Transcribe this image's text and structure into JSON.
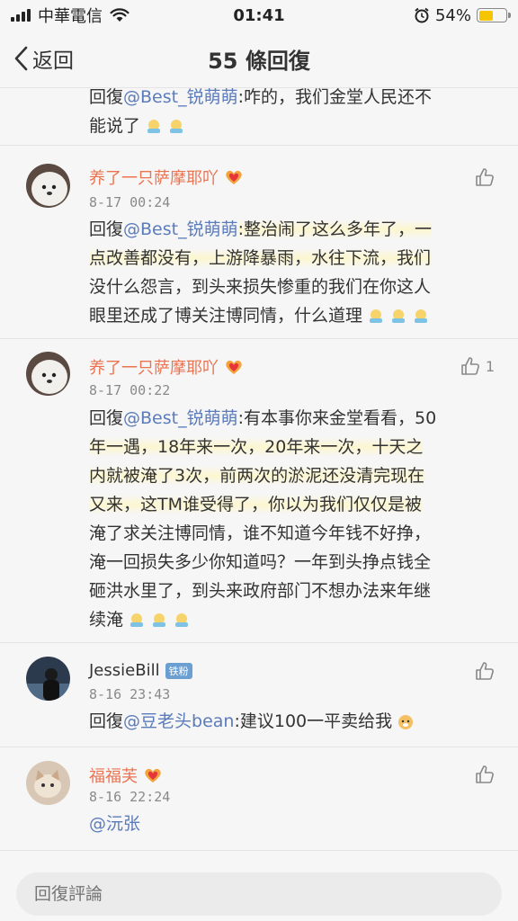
{
  "status_bar": {
    "carrier": "中華電信",
    "time": "01:41",
    "battery": "54%",
    "battery_level": 0.54
  },
  "nav": {
    "back_label": "返回",
    "title": "55 條回復"
  },
  "comments": [
    {
      "reply_prefix": "回復",
      "mention": "@Best_锐萌萌",
      "text": ":咋的，我们金堂人民还不能说了",
      "line1": ":咋的，我们金堂人民还不",
      "line2": "能说了"
    },
    {
      "username": "养了一只萨摩耶吖",
      "time": "8-17 00:24",
      "reply_prefix": "回復",
      "mention": "@Best_锐萌萌",
      "line1": ":整治闹了这么多年了，一",
      "line2": "点改善都没有，上游降暴雨，水往下流，我们",
      "line3": "没什么怨言，到头来损失惨重的我们在你这人",
      "line4": "眼里还成了博关注博同情，什么道理"
    },
    {
      "username": "养了一只萨摩耶吖",
      "time": "8-17 00:22",
      "likes": "1",
      "reply_prefix": "回復",
      "mention": "@Best_锐萌萌",
      "line1": ":有本事你来金堂看看，50",
      "line2": "年一遇，18年来一次，20年来一次，十天之",
      "line3": "内就被淹了3次，前两次的淤泥还没清完现在",
      "line4": "又来，这TM谁受得了，你以为我们仅仅是被",
      "line5": "淹了求关注博同情，谁不知道今年钱不好挣，",
      "line6": "淹一回损失多少你知道吗？一年到头挣点钱全",
      "line7": "砸洪水里了，到头来政府部门不想办法来年继",
      "line8": "续淹"
    },
    {
      "username": "JessieBill",
      "badge": "铁粉",
      "time": "8-16 23:43",
      "reply_prefix": "回復",
      "mention": "@豆老头bean",
      "text": ":建议100一平卖给我"
    },
    {
      "username": "福福芙",
      "time": "8-16 22:24",
      "mention": "@沅张"
    }
  ],
  "input": {
    "placeholder": "回復評論"
  },
  "colors": {
    "username": "#eb7350",
    "mention": "#5b7bbb",
    "time": "#8a8a8a",
    "badge": "#6c9fd1"
  }
}
